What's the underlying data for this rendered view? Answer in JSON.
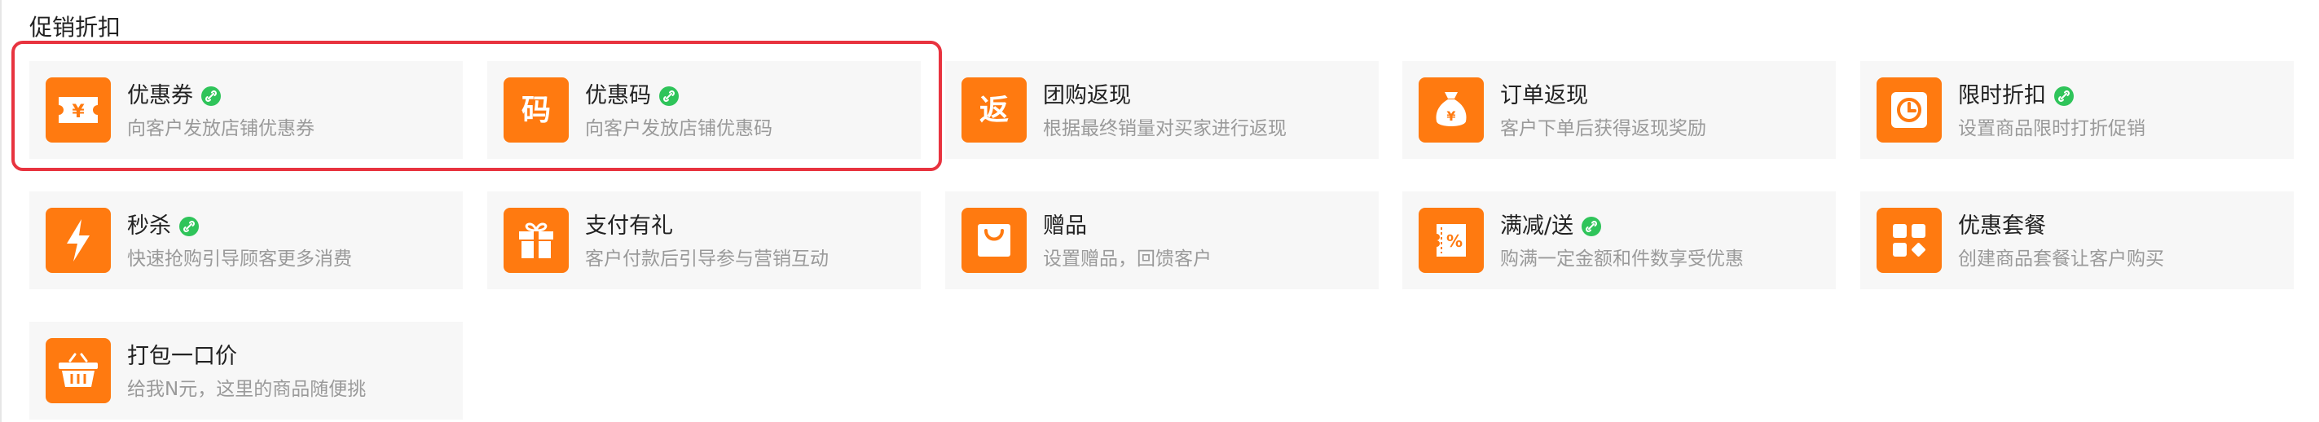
{
  "section": {
    "title": "促销折扣"
  },
  "colors": {
    "accent": "#ff7a10",
    "badge": "#2fc45a",
    "highlight": "#e8333f",
    "card_bg": "#f7f7f7"
  },
  "cards": [
    {
      "title": "优惠券",
      "desc": "向客户发放店铺优惠券",
      "icon": "coupon-icon",
      "badge": true
    },
    {
      "title": "优惠码",
      "desc": "向客户发放店铺优惠码",
      "icon": "code-icon",
      "badge": true,
      "icon_char": "码"
    },
    {
      "title": "团购返现",
      "desc": "根据最终销量对买家进行返现",
      "icon": "return-icon",
      "badge": false,
      "icon_char": "返"
    },
    {
      "title": "订单返现",
      "desc": "客户下单后获得返现奖励",
      "icon": "money-bag-icon",
      "badge": false
    },
    {
      "title": "限时折扣",
      "desc": "设置商品限时打折促销",
      "icon": "clock-icon",
      "badge": true
    },
    {
      "title": "秒杀",
      "desc": "快速抢购引导顾客更多消费",
      "icon": "lightning-icon",
      "badge": true
    },
    {
      "title": "支付有礼",
      "desc": "客户付款后引导参与营销互动",
      "icon": "gift-icon",
      "badge": false
    },
    {
      "title": "赠品",
      "desc": "设置赠品，回馈客户",
      "icon": "shopping-bag-icon",
      "badge": false
    },
    {
      "title": "满减/送",
      "desc": "购满一定金额和件数享受优惠",
      "icon": "percent-ticket-icon",
      "badge": true
    },
    {
      "title": "优惠套餐",
      "desc": "创建商品套餐让客户购买",
      "icon": "bundle-icon",
      "badge": false
    },
    {
      "title": "打包一口价",
      "desc": "给我N元，这里的商品随便挑",
      "icon": "basket-icon",
      "badge": false
    }
  ]
}
